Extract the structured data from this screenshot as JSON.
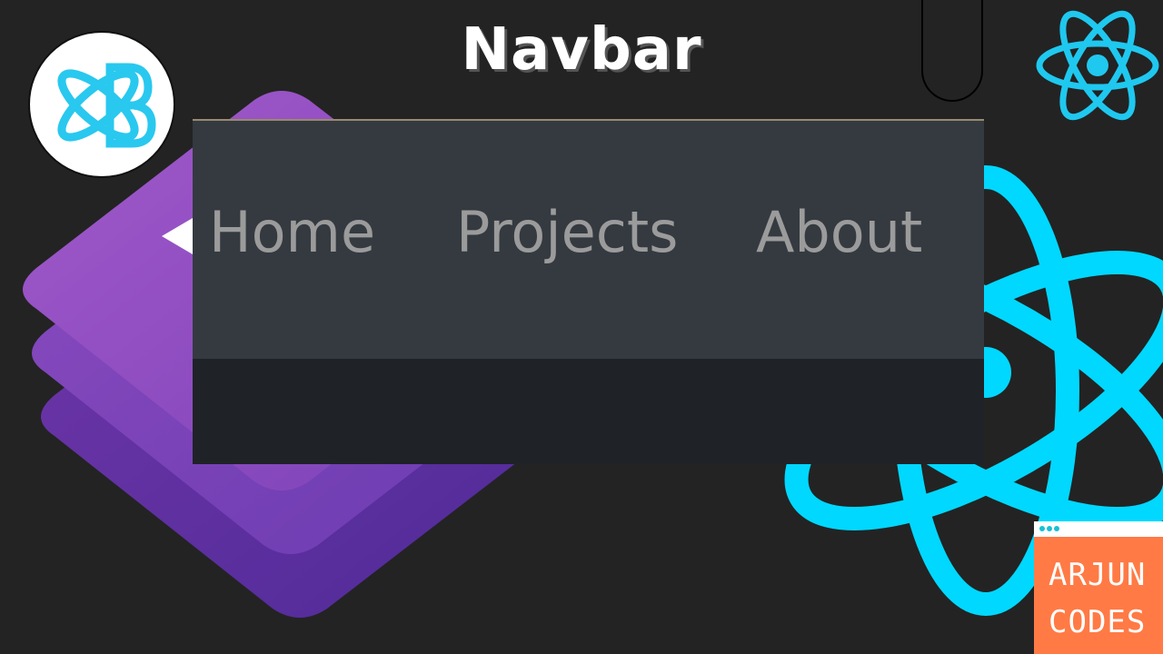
{
  "title": "Navbar",
  "navbar": {
    "links": [
      "Home",
      "Projects",
      "About"
    ]
  },
  "badge": {
    "line1": "ARJUN",
    "line2": "CODES"
  },
  "colors": {
    "background": "#232323",
    "react_blue": "#00d8ff",
    "bootstrap_purple": "#7b3fb8",
    "navbar_dark": "#343a40",
    "badge_orange": "#ff7a45"
  },
  "icons": [
    "bootstrap-stack-icon",
    "reactstrap-logo-icon",
    "react-logo-icon",
    "react-atom-large-icon"
  ]
}
